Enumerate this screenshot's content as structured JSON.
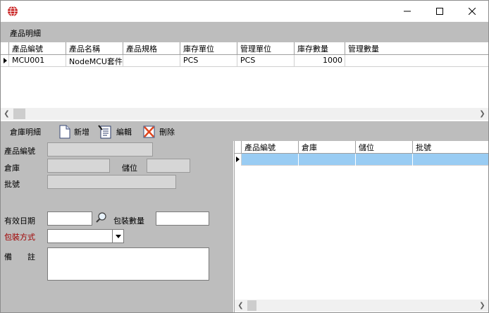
{
  "top_section": {
    "title": "產品明細",
    "columns": [
      "產品編號",
      "產品名稱",
      "產品規格",
      "庫存單位",
      "管理單位",
      "庫存數量",
      "管理數量"
    ],
    "rows": [
      {
        "code": "MCU001",
        "name": "NodeMCU套件",
        "spec": "",
        "stock_unit": "PCS",
        "mgmt_unit": "PCS",
        "stock_qty": "1000",
        "mgmt_qty": ""
      }
    ]
  },
  "bottom_section": {
    "title": "倉庫明細",
    "toolbar": {
      "add_label": "新增",
      "edit_label": "編輯",
      "delete_label": "刪除"
    }
  },
  "form": {
    "product_code_label": "產品編號",
    "warehouse_label": "倉庫",
    "location_label": "儲位",
    "batch_label": "批號",
    "expiry_label": "有效日期",
    "pack_qty_label": "包裝數量",
    "pack_method_label": "包裝方式",
    "remark_label": "備　　註"
  },
  "right_grid": {
    "columns": [
      "產品編號",
      "倉庫",
      "儲位",
      "批號"
    ]
  },
  "colors": {
    "panel": "#bdbdbd",
    "selected_row": "#99ccf3",
    "required_label": "#a00000"
  }
}
